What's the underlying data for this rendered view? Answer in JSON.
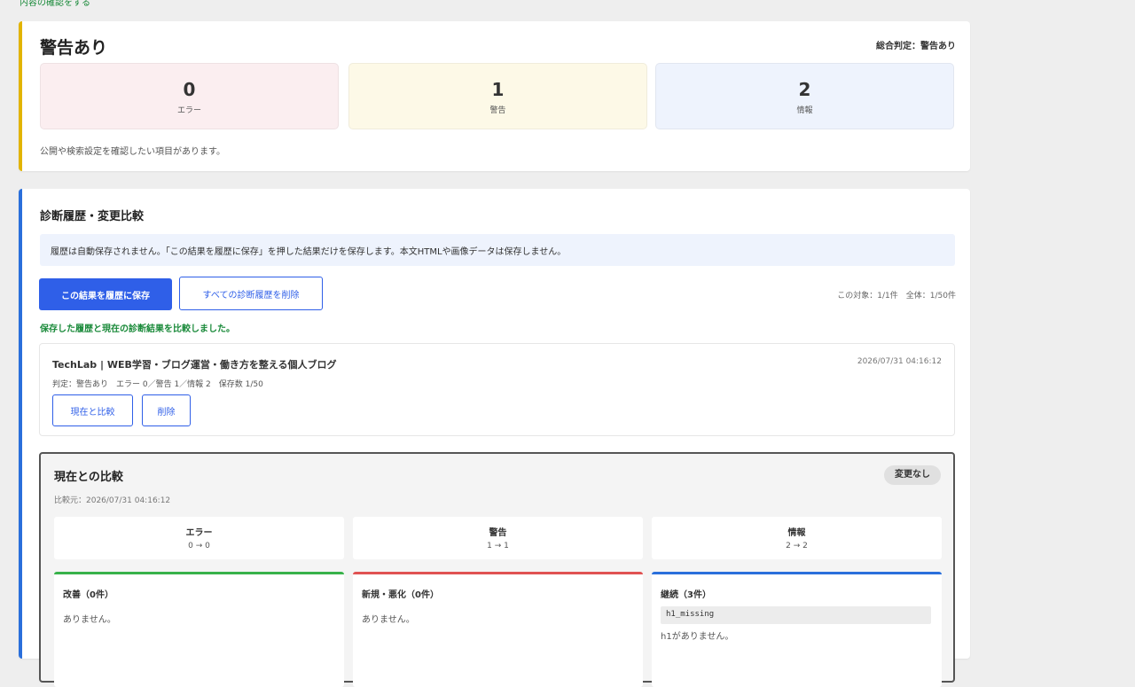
{
  "top_link": "内容の確認をする",
  "summary": {
    "title": "警告あり",
    "overall": "総合判定：警告あり",
    "stats": {
      "error": {
        "value": "0",
        "label": "エラー"
      },
      "warn": {
        "value": "1",
        "label": "警告"
      },
      "info": {
        "value": "2",
        "label": "情報"
      }
    },
    "note": "公開や検索設定を確認したい項目があります。"
  },
  "history": {
    "title": "診断履歴・変更比較",
    "notice": "履歴は自動保存されません。「この結果を履歴に保存」を押した結果だけを保存します。本文HTMLや画像データは保存しません。",
    "save_button": "この結果を履歴に保存",
    "delete_all_button": "すべての診断履歴を削除",
    "count_info": "この対象：1/1件　全体：1/50件",
    "compare_message": "保存した履歴と現在の診断結果を比較しました。",
    "entry": {
      "title": "TechLab | WEB学習・ブログ運営・働き方を整える個人ブログ",
      "date": "2026/07/31 04:16:12",
      "meta": "判定：警告あり　エラー 0／警告 1／情報 2　保存数 1/50",
      "compare_button": "現在と比較",
      "delete_button": "削除"
    },
    "comparison": {
      "title": "現在との比較",
      "badge": "変更なし",
      "date": "比較元：2026/07/31 04:16:12",
      "stats": {
        "error": {
          "label": "エラー",
          "value": "0 → 0"
        },
        "warn": {
          "label": "警告",
          "value": "1 → 1"
        },
        "info": {
          "label": "情報",
          "value": "2 → 2"
        }
      },
      "columns": {
        "improved": {
          "title": "改善（0件）",
          "body": "ありません。"
        },
        "new": {
          "title": "新規・悪化（0件）",
          "body": "ありません。"
        },
        "continued": {
          "title": "継続（3件）",
          "code": "h1_missing",
          "desc": "h1がありません。"
        }
      }
    }
  },
  "colors": {
    "warn_accent": "#e2b400",
    "info_accent": "#2a6fdb",
    "primary": "#2f5fe8",
    "success": "#1a8a3a",
    "danger": "#e05252",
    "improved": "#38b24a"
  }
}
